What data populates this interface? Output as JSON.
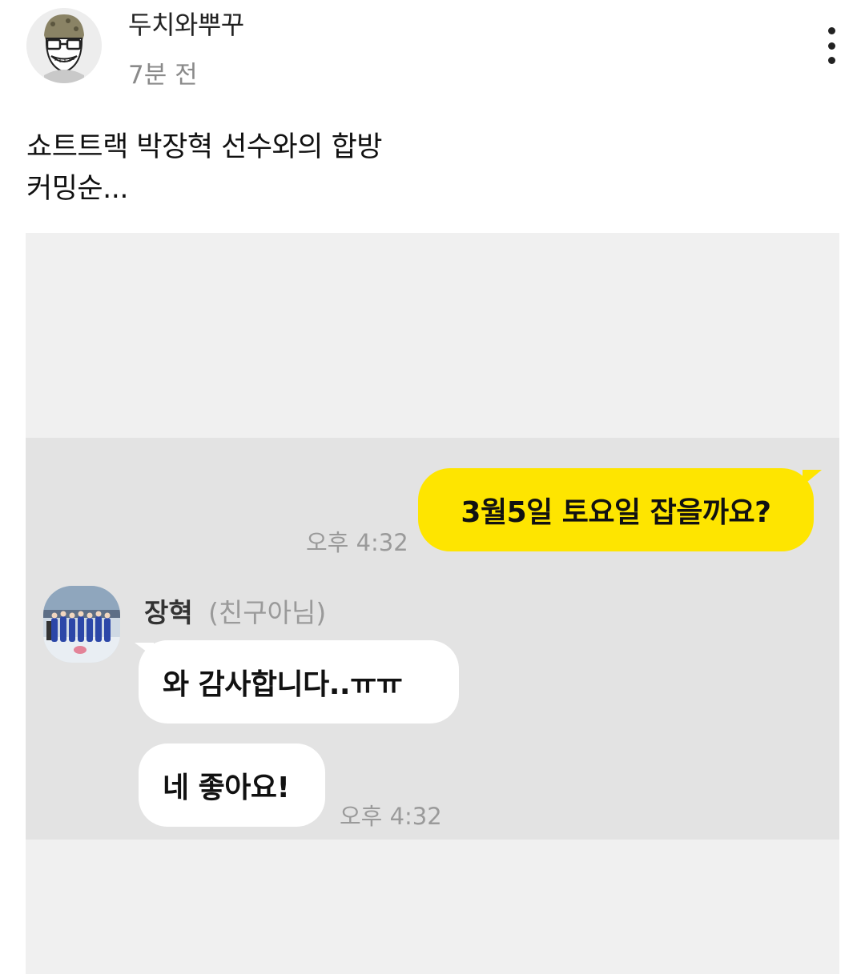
{
  "post": {
    "author": "두치와뿌꾸",
    "time": "7분 전",
    "body_lines": [
      "쇼트트랙 박장혁 선수와의 합방",
      "커밍순..."
    ]
  },
  "chat": {
    "my_message": "3월5일 토요일 잡을까요?",
    "my_time": "오후 4:32",
    "friend_name": "장혁",
    "friend_tag": "(친구아님)",
    "friend_messages": [
      "와 감사합니다..ㅠㅠ",
      "네 좋아요!"
    ],
    "friend_time": "오후 4:32"
  },
  "icons": {
    "author_avatar": "cartoon-face-avatar",
    "more": "more-vertical-icon",
    "friend_avatar": "team-photo-avatar"
  },
  "colors": {
    "my_bubble": "#fee500",
    "chat_background": "#e3e3e3",
    "friend_bubble": "#ffffff"
  }
}
